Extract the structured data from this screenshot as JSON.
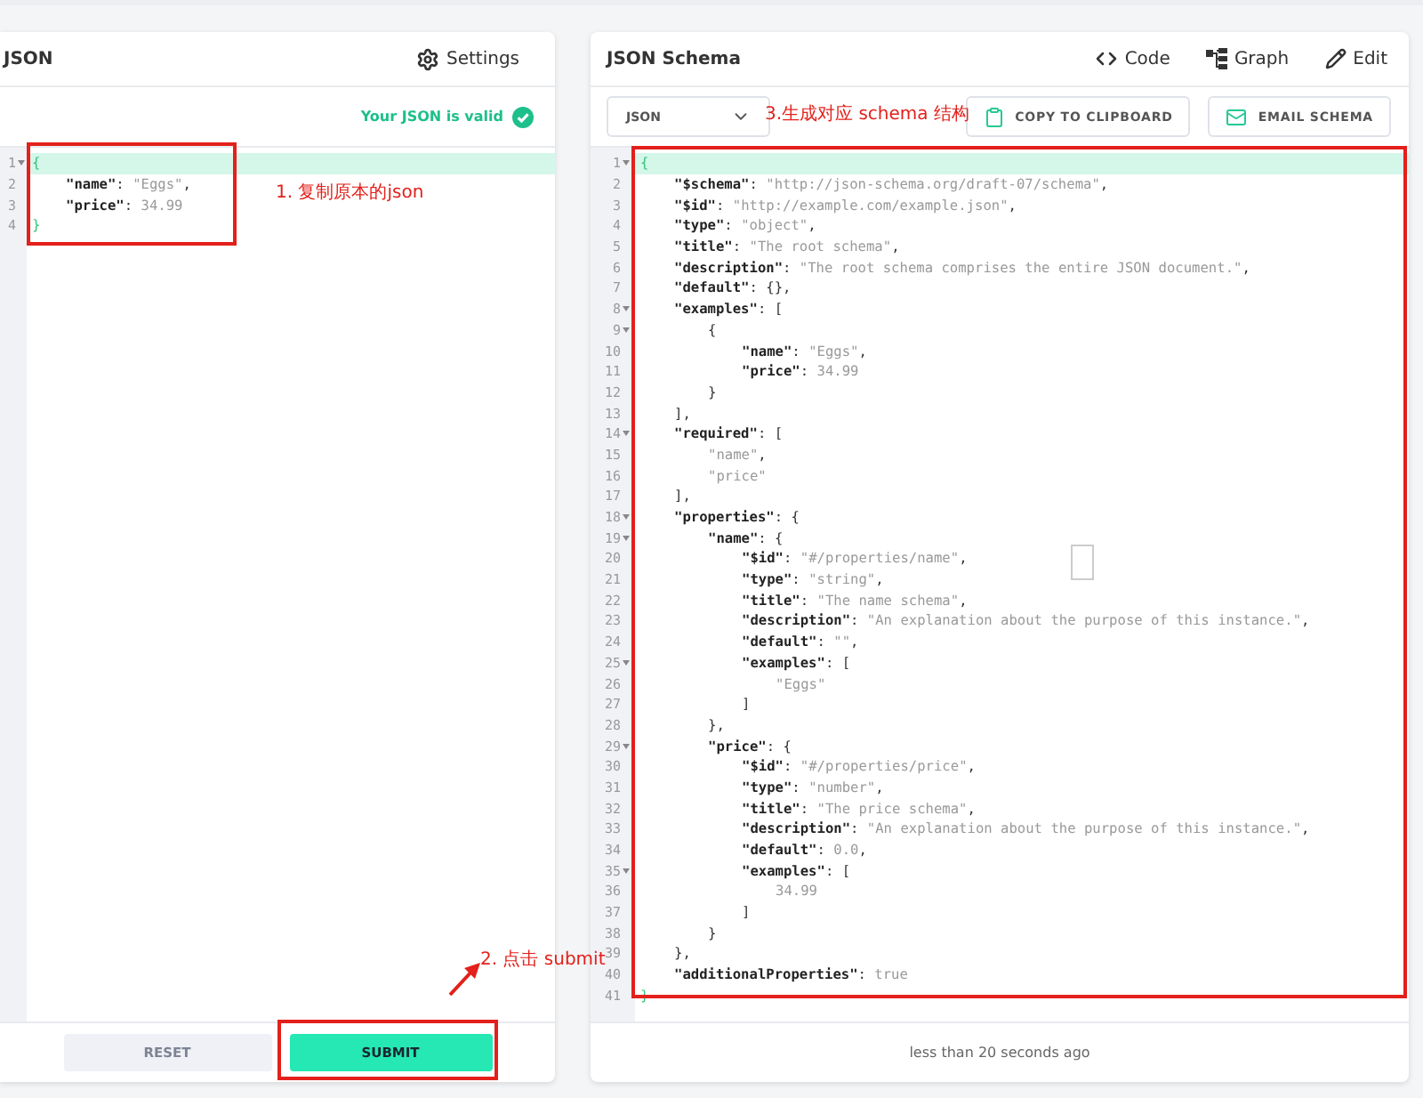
{
  "input_panel": {
    "title": "JSON",
    "settings_label": "Settings",
    "validation": {
      "valid": true,
      "text": "Your JSON is valid"
    },
    "lines": [
      {
        "n": "1",
        "fold": true,
        "highlighted": true,
        "tokens": [
          {
            "kind": "brace",
            "text": "{"
          }
        ]
      },
      {
        "n": "2",
        "fold": false,
        "highlighted": false,
        "tokens": [
          {
            "kind": "key",
            "text": "\"name\""
          },
          {
            "kind": "punct",
            "text": ": "
          },
          {
            "kind": "value",
            "text": "\"Eggs\""
          },
          {
            "kind": "punct",
            "text": ","
          }
        ]
      },
      {
        "n": "3",
        "fold": false,
        "highlighted": false,
        "tokens": [
          {
            "kind": "key",
            "text": "\"price\""
          },
          {
            "kind": "punct",
            "text": ": "
          },
          {
            "kind": "value",
            "text": "34.99"
          }
        ]
      },
      {
        "n": "4",
        "fold": false,
        "highlighted": false,
        "tokens": [
          {
            "kind": "brace",
            "text": "}"
          }
        ]
      }
    ],
    "buttons": [
      {
        "kind": "secondary",
        "label": "RESET"
      },
      {
        "kind": "primary",
        "label": "SUBMIT"
      }
    ]
  },
  "schema_panel": {
    "title": "JSON Schema",
    "views": [
      {
        "kind": "code",
        "label": "Code"
      },
      {
        "kind": "graph",
        "label": "Graph"
      },
      {
        "kind": "edit",
        "label": "Edit"
      }
    ],
    "format_select": {
      "value": "JSON"
    },
    "actions": [
      {
        "kind": "copy",
        "label": "COPY TO CLIPBOARD"
      },
      {
        "kind": "email",
        "label": "EMAIL SCHEMA"
      }
    ],
    "lines": [
      {
        "n": "1",
        "fold": true,
        "highlighted": true,
        "tokens": [
          {
            "kind": "brace",
            "text": "{"
          }
        ]
      },
      {
        "n": "2",
        "fold": false,
        "highlighted": false,
        "tokens": [
          {
            "kind": "key",
            "text": "\"$schema\""
          },
          {
            "kind": "punct",
            "text": ": "
          },
          {
            "kind": "value",
            "text": "\"http://json-schema.org/draft-07/schema\""
          },
          {
            "kind": "punct",
            "text": ","
          }
        ]
      },
      {
        "n": "3",
        "fold": false,
        "highlighted": false,
        "tokens": [
          {
            "kind": "key",
            "text": "\"$id\""
          },
          {
            "kind": "punct",
            "text": ": "
          },
          {
            "kind": "value",
            "text": "\"http://example.com/example.json\""
          },
          {
            "kind": "punct",
            "text": ","
          }
        ]
      },
      {
        "n": "4",
        "fold": false,
        "highlighted": false,
        "tokens": [
          {
            "kind": "key",
            "text": "\"type\""
          },
          {
            "kind": "punct",
            "text": ": "
          },
          {
            "kind": "value",
            "text": "\"object\""
          },
          {
            "kind": "punct",
            "text": ","
          }
        ]
      },
      {
        "n": "5",
        "fold": false,
        "highlighted": false,
        "tokens": [
          {
            "kind": "key",
            "text": "\"title\""
          },
          {
            "kind": "punct",
            "text": ": "
          },
          {
            "kind": "value",
            "text": "\"The root schema\""
          },
          {
            "kind": "punct",
            "text": ","
          }
        ]
      },
      {
        "n": "6",
        "fold": false,
        "highlighted": false,
        "tokens": [
          {
            "kind": "key",
            "text": "\"description\""
          },
          {
            "kind": "punct",
            "text": ": "
          },
          {
            "kind": "value",
            "text": "\"The root schema comprises the entire JSON document.\""
          },
          {
            "kind": "punct",
            "text": ","
          }
        ]
      },
      {
        "n": "7",
        "fold": false,
        "highlighted": false,
        "tokens": [
          {
            "kind": "key",
            "text": "\"default\""
          },
          {
            "kind": "punct",
            "text": ": {},"
          }
        ]
      },
      {
        "n": "8",
        "fold": true,
        "highlighted": false,
        "tokens": [
          {
            "kind": "key",
            "text": "\"examples\""
          },
          {
            "kind": "punct",
            "text": ": ["
          }
        ]
      },
      {
        "n": "9",
        "fold": true,
        "highlighted": false,
        "tokens": [
          {
            "kind": "punct",
            "text": "{"
          }
        ]
      },
      {
        "n": "10",
        "fold": false,
        "highlighted": false,
        "tokens": [
          {
            "kind": "key",
            "text": "\"name\""
          },
          {
            "kind": "punct",
            "text": ": "
          },
          {
            "kind": "value",
            "text": "\"Eggs\""
          },
          {
            "kind": "punct",
            "text": ","
          }
        ]
      },
      {
        "n": "11",
        "fold": false,
        "highlighted": false,
        "tokens": [
          {
            "kind": "key",
            "text": "\"price\""
          },
          {
            "kind": "punct",
            "text": ": "
          },
          {
            "kind": "value",
            "text": "34.99"
          }
        ]
      },
      {
        "n": "12",
        "fold": false,
        "highlighted": false,
        "tokens": [
          {
            "kind": "punct",
            "text": "}"
          }
        ]
      },
      {
        "n": "13",
        "fold": false,
        "highlighted": false,
        "tokens": [
          {
            "kind": "punct",
            "text": "],"
          }
        ]
      },
      {
        "n": "14",
        "fold": true,
        "highlighted": false,
        "tokens": [
          {
            "kind": "key",
            "text": "\"required\""
          },
          {
            "kind": "punct",
            "text": ": ["
          }
        ]
      },
      {
        "n": "15",
        "fold": false,
        "highlighted": false,
        "tokens": [
          {
            "kind": "value",
            "text": "\"name\""
          },
          {
            "kind": "punct",
            "text": ","
          }
        ]
      },
      {
        "n": "16",
        "fold": false,
        "highlighted": false,
        "tokens": [
          {
            "kind": "value",
            "text": "\"price\""
          }
        ]
      },
      {
        "n": "17",
        "fold": false,
        "highlighted": false,
        "tokens": [
          {
            "kind": "punct",
            "text": "],"
          }
        ]
      },
      {
        "n": "18",
        "fold": true,
        "highlighted": false,
        "tokens": [
          {
            "kind": "key",
            "text": "\"properties\""
          },
          {
            "kind": "punct",
            "text": ": {"
          }
        ]
      },
      {
        "n": "19",
        "fold": true,
        "highlighted": false,
        "tokens": [
          {
            "kind": "key",
            "text": "\"name\""
          },
          {
            "kind": "punct",
            "text": ": {"
          }
        ]
      },
      {
        "n": "20",
        "fold": false,
        "highlighted": false,
        "tokens": [
          {
            "kind": "key",
            "text": "\"$id\""
          },
          {
            "kind": "punct",
            "text": ": "
          },
          {
            "kind": "value",
            "text": "\"#/properties/name\""
          },
          {
            "kind": "punct",
            "text": ","
          }
        ]
      },
      {
        "n": "21",
        "fold": false,
        "highlighted": false,
        "tokens": [
          {
            "kind": "key",
            "text": "\"type\""
          },
          {
            "kind": "punct",
            "text": ": "
          },
          {
            "kind": "value",
            "text": "\"string\""
          },
          {
            "kind": "punct",
            "text": ","
          }
        ]
      },
      {
        "n": "22",
        "fold": false,
        "highlighted": false,
        "tokens": [
          {
            "kind": "key",
            "text": "\"title\""
          },
          {
            "kind": "punct",
            "text": ": "
          },
          {
            "kind": "value",
            "text": "\"The name schema\""
          },
          {
            "kind": "punct",
            "text": ","
          }
        ]
      },
      {
        "n": "23",
        "fold": false,
        "highlighted": false,
        "tokens": [
          {
            "kind": "key",
            "text": "\"description\""
          },
          {
            "kind": "punct",
            "text": ": "
          },
          {
            "kind": "value",
            "text": "\"An explanation about the purpose of this instance.\""
          },
          {
            "kind": "punct",
            "text": ","
          }
        ]
      },
      {
        "n": "24",
        "fold": false,
        "highlighted": false,
        "tokens": [
          {
            "kind": "key",
            "text": "\"default\""
          },
          {
            "kind": "punct",
            "text": ": "
          },
          {
            "kind": "value",
            "text": "\"\""
          },
          {
            "kind": "punct",
            "text": ","
          }
        ]
      },
      {
        "n": "25",
        "fold": true,
        "highlighted": false,
        "tokens": [
          {
            "kind": "key",
            "text": "\"examples\""
          },
          {
            "kind": "punct",
            "text": ": ["
          }
        ]
      },
      {
        "n": "26",
        "fold": false,
        "highlighted": false,
        "tokens": [
          {
            "kind": "value",
            "text": "\"Eggs\""
          }
        ]
      },
      {
        "n": "27",
        "fold": false,
        "highlighted": false,
        "tokens": [
          {
            "kind": "punct",
            "text": "]"
          }
        ]
      },
      {
        "n": "28",
        "fold": false,
        "highlighted": false,
        "tokens": [
          {
            "kind": "punct",
            "text": "},"
          }
        ]
      },
      {
        "n": "29",
        "fold": true,
        "highlighted": false,
        "tokens": [
          {
            "kind": "key",
            "text": "\"price\""
          },
          {
            "kind": "punct",
            "text": ": {"
          }
        ]
      },
      {
        "n": "30",
        "fold": false,
        "highlighted": false,
        "tokens": [
          {
            "kind": "key",
            "text": "\"$id\""
          },
          {
            "kind": "punct",
            "text": ": "
          },
          {
            "kind": "value",
            "text": "\"#/properties/price\""
          },
          {
            "kind": "punct",
            "text": ","
          }
        ]
      },
      {
        "n": "31",
        "fold": false,
        "highlighted": false,
        "tokens": [
          {
            "kind": "key",
            "text": "\"type\""
          },
          {
            "kind": "punct",
            "text": ": "
          },
          {
            "kind": "value",
            "text": "\"number\""
          },
          {
            "kind": "punct",
            "text": ","
          }
        ]
      },
      {
        "n": "32",
        "fold": false,
        "highlighted": false,
        "tokens": [
          {
            "kind": "key",
            "text": "\"title\""
          },
          {
            "kind": "punct",
            "text": ": "
          },
          {
            "kind": "value",
            "text": "\"The price schema\""
          },
          {
            "kind": "punct",
            "text": ","
          }
        ]
      },
      {
        "n": "33",
        "fold": false,
        "highlighted": false,
        "tokens": [
          {
            "kind": "key",
            "text": "\"description\""
          },
          {
            "kind": "punct",
            "text": ": "
          },
          {
            "kind": "value",
            "text": "\"An explanation about the purpose of this instance.\""
          },
          {
            "kind": "punct",
            "text": ","
          }
        ]
      },
      {
        "n": "34",
        "fold": false,
        "highlighted": false,
        "tokens": [
          {
            "kind": "key",
            "text": "\"default\""
          },
          {
            "kind": "punct",
            "text": ": "
          },
          {
            "kind": "value",
            "text": "0.0"
          },
          {
            "kind": "punct",
            "text": ","
          }
        ]
      },
      {
        "n": "35",
        "fold": true,
        "highlighted": false,
        "tokens": [
          {
            "kind": "key",
            "text": "\"examples\""
          },
          {
            "kind": "punct",
            "text": ": ["
          }
        ]
      },
      {
        "n": "36",
        "fold": false,
        "highlighted": false,
        "tokens": [
          {
            "kind": "value",
            "text": "34.99"
          }
        ]
      },
      {
        "n": "37",
        "fold": false,
        "highlighted": false,
        "tokens": [
          {
            "kind": "punct",
            "text": "]"
          }
        ]
      },
      {
        "n": "38",
        "fold": false,
        "highlighted": false,
        "tokens": [
          {
            "kind": "punct",
            "text": "}"
          }
        ]
      },
      {
        "n": "39",
        "fold": false,
        "highlighted": false,
        "tokens": [
          {
            "kind": "punct",
            "text": "},"
          }
        ]
      },
      {
        "n": "40",
        "fold": false,
        "highlighted": false,
        "tokens": [
          {
            "kind": "key",
            "text": "\"additionalProperties\""
          },
          {
            "kind": "punct",
            "text": ": "
          },
          {
            "kind": "value",
            "text": "true"
          }
        ]
      },
      {
        "n": "41",
        "fold": false,
        "highlighted": false,
        "tokens": [
          {
            "kind": "brace",
            "text": "}"
          }
        ]
      }
    ],
    "timestamp": "less than 20 seconds ago"
  },
  "annotations": [
    {
      "text": "1. 复制原本的json"
    },
    {
      "text": "2. 点击 submit"
    },
    {
      "text": "3.生成对应 schema 结构"
    }
  ]
}
